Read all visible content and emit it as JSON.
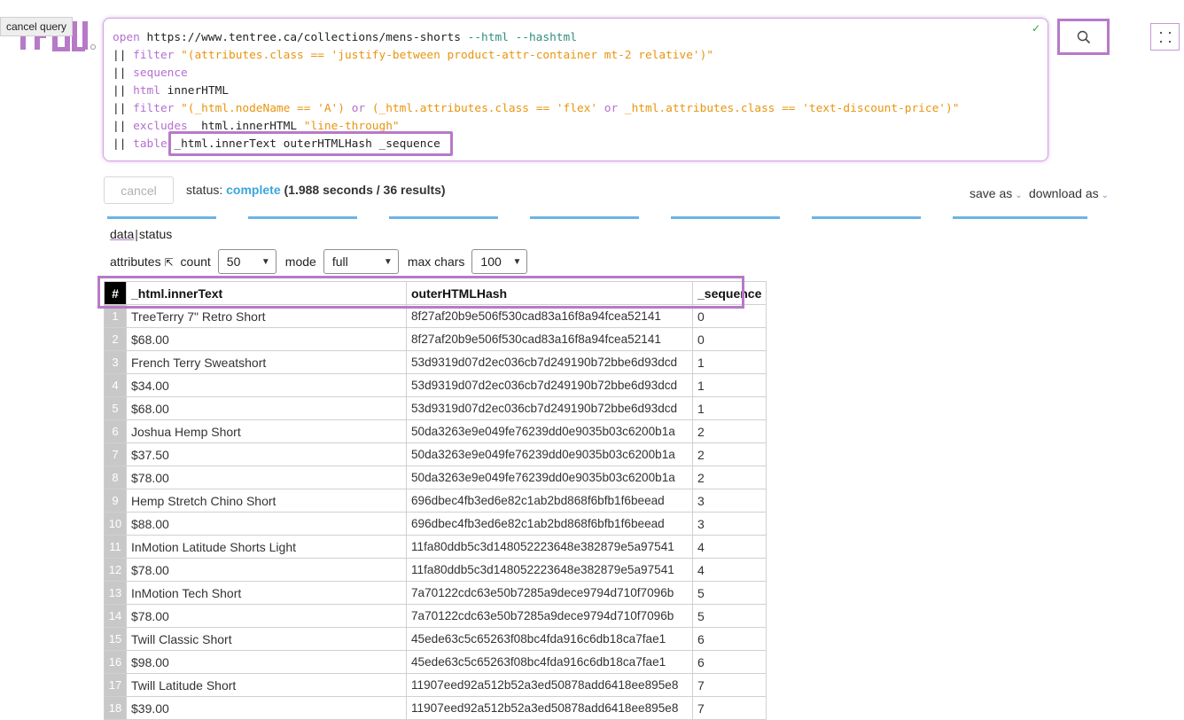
{
  "tooltip": "cancel query",
  "query": {
    "lines": [
      [
        {
          "t": "open",
          "c": "kw"
        },
        {
          "t": " https://www.tentree.ca/collections/mens-shorts ",
          "c": ""
        },
        {
          "t": "--html --hashtml",
          "c": "op"
        }
      ],
      [
        {
          "t": "|| ",
          "c": ""
        },
        {
          "t": "filter",
          "c": "kw"
        },
        {
          "t": " \"(attributes.class == 'justify-between product-attr-container mt-2 relative')\"",
          "c": "str"
        }
      ],
      [
        {
          "t": "|| ",
          "c": ""
        },
        {
          "t": "sequence",
          "c": "kw"
        }
      ],
      [
        {
          "t": "|| ",
          "c": ""
        },
        {
          "t": "html",
          "c": "kw"
        },
        {
          "t": " innerHTML",
          "c": ""
        }
      ],
      [
        {
          "t": "|| ",
          "c": ""
        },
        {
          "t": "filter",
          "c": "kw"
        },
        {
          "t": " \"(_html.nodeName == 'A') ",
          "c": "str"
        },
        {
          "t": "or",
          "c": "kw"
        },
        {
          "t": " (_html.attributes.class == 'flex' ",
          "c": "str"
        },
        {
          "t": "or",
          "c": "kw"
        },
        {
          "t": " _html.attributes.class == 'text-discount-price')\"",
          "c": "str"
        }
      ],
      [
        {
          "t": "|| ",
          "c": ""
        },
        {
          "t": "excludes",
          "c": "kw"
        },
        {
          "t": " _html.innerHTML ",
          "c": ""
        },
        {
          "t": "\"line-through\"",
          "c": "str"
        }
      ],
      [
        {
          "t": "|| ",
          "c": ""
        },
        {
          "t": "table",
          "c": "kw"
        },
        {
          "t": " _html.innerText outerHTMLHash _sequence",
          "c": ""
        }
      ]
    ]
  },
  "toolbar": {
    "cancel_label": "cancel",
    "status_label": "status:",
    "status_value": "complete",
    "status_detail": "(1.988 seconds / 36 results)",
    "save_as": "save as",
    "download_as": "download as"
  },
  "view_tabs": {
    "data": "data",
    "sep": "|",
    "status": "status"
  },
  "controls": {
    "attributes_label": "attributes",
    "attributes_icon": "⇱",
    "count_label": "count",
    "count_value": "50",
    "mode_label": "mode",
    "mode_value": "full",
    "maxchars_label": "max chars",
    "maxchars_value": "100"
  },
  "colors": {
    "accent": "#b77ac8",
    "status": "#3aa6dd",
    "tab_bar": "#6cb3e6"
  },
  "table": {
    "headers": [
      "#",
      "_html.innerText",
      "outerHTMLHash",
      "_sequence"
    ],
    "rows": [
      [
        "1",
        "TreeTerry 7\" Retro Short",
        "8f27af20b9e506f530cad83a16f8a94fcea52141",
        "0"
      ],
      [
        "2",
        "$68.00",
        "8f27af20b9e506f530cad83a16f8a94fcea52141",
        "0"
      ],
      [
        "3",
        "French Terry Sweatshort",
        "53d9319d07d2ec036cb7d249190b72bbe6d93dcd",
        "1"
      ],
      [
        "4",
        "$34.00",
        "53d9319d07d2ec036cb7d249190b72bbe6d93dcd",
        "1"
      ],
      [
        "5",
        "$68.00",
        "53d9319d07d2ec036cb7d249190b72bbe6d93dcd",
        "1"
      ],
      [
        "6",
        "Joshua Hemp Short",
        "50da3263e9e049fe76239dd0e9035b03c6200b1a",
        "2"
      ],
      [
        "7",
        "$37.50",
        "50da3263e9e049fe76239dd0e9035b03c6200b1a",
        "2"
      ],
      [
        "8",
        "$78.00",
        "50da3263e9e049fe76239dd0e9035b03c6200b1a",
        "2"
      ],
      [
        "9",
        "Hemp Stretch Chino Short",
        "696dbec4fb3ed6e82c1ab2bd868f6bfb1f6beead",
        "3"
      ],
      [
        "10",
        "$88.00",
        "696dbec4fb3ed6e82c1ab2bd868f6bfb1f6beead",
        "3"
      ],
      [
        "11",
        "InMotion Latitude Shorts Light",
        "11fa80ddb5c3d148052223648e382879e5a97541",
        "4"
      ],
      [
        "12",
        "$78.00",
        "11fa80ddb5c3d148052223648e382879e5a97541",
        "4"
      ],
      [
        "13",
        "InMotion Tech Short",
        "7a70122cdc63e50b7285a9dece9794d710f7096b",
        "5"
      ],
      [
        "14",
        "$78.00",
        "7a70122cdc63e50b7285a9dece9794d710f7096b",
        "5"
      ],
      [
        "15",
        "Twill Classic Short",
        "45ede63c5c65263f08bc4fda916c6db18ca7fae1",
        "6"
      ],
      [
        "16",
        "$98.00",
        "45ede63c5c65263f08bc4fda916c6db18ca7fae1",
        "6"
      ],
      [
        "17",
        "Twill Latitude Short",
        "11907eed92a512b52a3ed50878add6418ee895e8",
        "7"
      ],
      [
        "18",
        "$39.00",
        "11907eed92a512b52a3ed50878add6418ee895e8",
        "7"
      ]
    ]
  }
}
